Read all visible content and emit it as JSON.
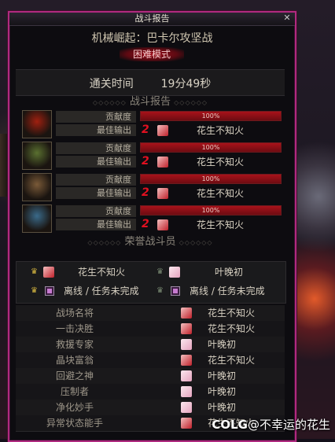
{
  "window": {
    "title": "战斗报告"
  },
  "header": {
    "dungeon_name": "机械崛起：巴卡尔攻坚战",
    "mode": "困难模式"
  },
  "clear": {
    "label": "通关时间",
    "time": "19分49秒"
  },
  "battle_report": {
    "section_title": "战斗报告",
    "players": [
      {
        "contribution_label": "贡献度",
        "contribution_pct": "100%",
        "contribution_fraction": 1.0,
        "top_output_label": "最佳输出",
        "rank": "2",
        "top_name": "花生不知火",
        "portrait": "dark-knight-red",
        "portrait_color": "#a02010"
      },
      {
        "contribution_label": "贡献度",
        "contribution_pct": "100%",
        "contribution_fraction": 1.0,
        "top_output_label": "最佳输出",
        "rank": "2",
        "top_name": "花生不知火",
        "portrait": "armor-green",
        "portrait_color": "#5a7030"
      },
      {
        "contribution_label": "贡献度",
        "contribution_pct": "100%",
        "contribution_fraction": 1.0,
        "top_output_label": "最佳输出",
        "rank": "2",
        "top_name": "花生不知火",
        "portrait": "armor-bronze",
        "portrait_color": "#7a5a38"
      },
      {
        "contribution_label": "贡献度",
        "contribution_pct": "100%",
        "contribution_fraction": 1.0,
        "top_output_label": "最佳输出",
        "rank": "2",
        "top_name": "花生不知火",
        "portrait": "armor-blue",
        "portrait_color": "#3a6a8a"
      }
    ]
  },
  "honor": {
    "section_title": "荣誉战斗员",
    "cells": [
      {
        "name": "花生不知火"
      },
      {
        "name": "叶晚初"
      },
      {
        "name": "离线 / 任务未完成"
      },
      {
        "name": "离线 / 任务未完成"
      }
    ]
  },
  "awards": [
    {
      "title": "战场名将",
      "name": "花生不知火",
      "avatar": "red"
    },
    {
      "title": "一击决胜",
      "name": "花生不知火",
      "avatar": "red"
    },
    {
      "title": "救援专家",
      "name": "叶晚初",
      "avatar": "pink"
    },
    {
      "title": "晶块富翁",
      "name": "花生不知火",
      "avatar": "red"
    },
    {
      "title": "回避之神",
      "name": "叶晚初",
      "avatar": "pink"
    },
    {
      "title": "压制者",
      "name": "叶晚初",
      "avatar": "pink"
    },
    {
      "title": "净化妙手",
      "name": "叶晚初",
      "avatar": "pink"
    },
    {
      "title": "异常状态能手",
      "name": "花生不知火",
      "avatar": "red"
    }
  ],
  "watermark": {
    "brand": "COLG",
    "handle": "@不幸运的花生"
  },
  "colors": {
    "frame": "#b02a80",
    "bar": "#a8121a",
    "mode_bg": "#a0101c"
  }
}
